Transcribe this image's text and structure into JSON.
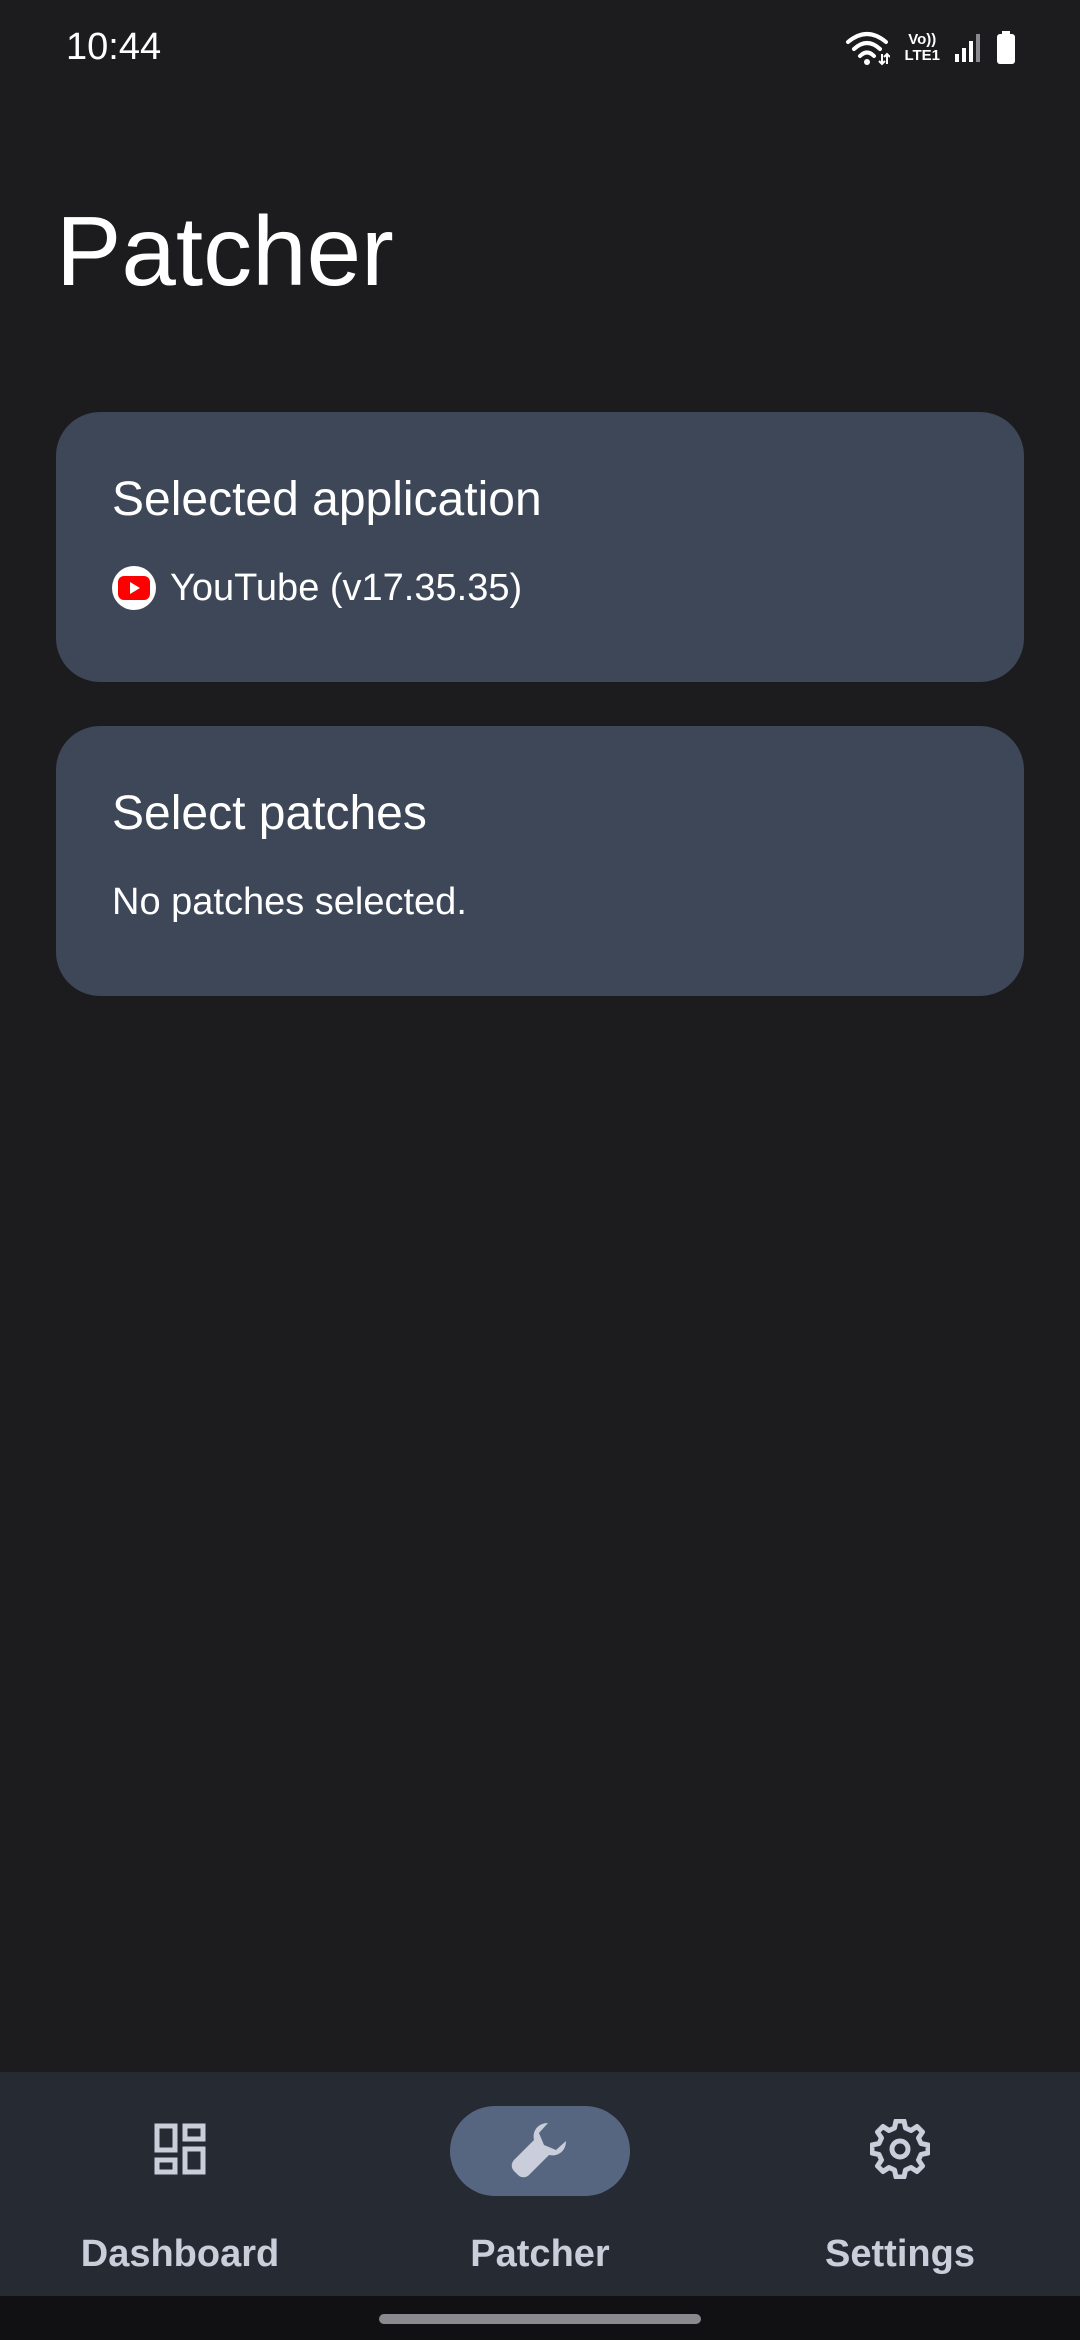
{
  "status_bar": {
    "time": "10:44",
    "lte_top": "Vo))",
    "lte_bottom": "LTE1",
    "icons": [
      "wifi-icon",
      "lte-icon",
      "signal-icon",
      "battery-icon"
    ]
  },
  "page": {
    "title": "Patcher"
  },
  "cards": {
    "selected_application": {
      "title": "Selected application",
      "app_icon": "youtube-icon",
      "app_name": "YouTube (v17.35.35)"
    },
    "select_patches": {
      "title": "Select patches",
      "status": "No patches selected."
    }
  },
  "bottom_nav": {
    "items": [
      {
        "label": "Dashboard",
        "icon": "dashboard-icon",
        "active": false
      },
      {
        "label": "Patcher",
        "icon": "wrench-icon",
        "active": true
      },
      {
        "label": "Settings",
        "icon": "gear-icon",
        "active": false
      }
    ]
  },
  "colors": {
    "background": "#1c1c1e",
    "card": "#3d4758",
    "nav_background": "#262a33",
    "active_pill": "#566681",
    "nav_label": "#c9ceda",
    "youtube_red": "#ff0000"
  }
}
